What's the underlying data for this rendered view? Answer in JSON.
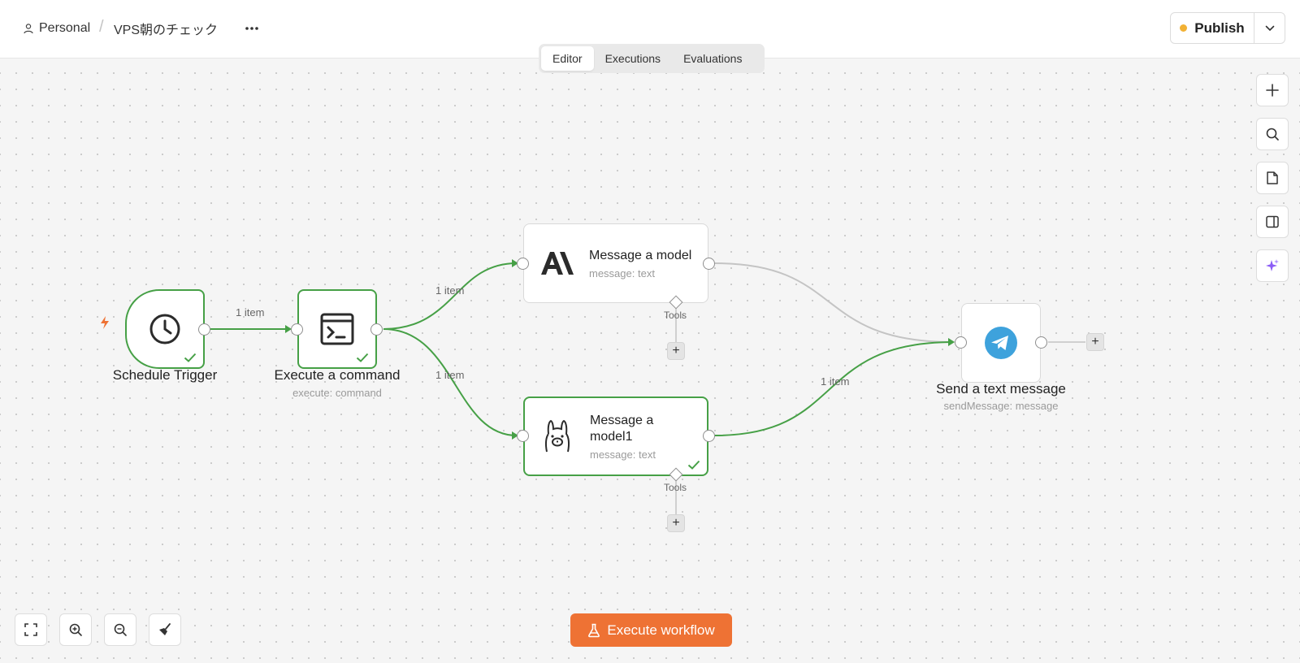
{
  "header": {
    "breadcrumb_personal": "Personal",
    "breadcrumb_separator": "/",
    "workflow_name": "VPS朝のチェック",
    "tabs": [
      {
        "label": "Editor",
        "active": true
      },
      {
        "label": "Executions",
        "active": false
      },
      {
        "label": "Evaluations",
        "active": false
      }
    ],
    "publish_label": "Publish",
    "publish_status_color": "#f2b134"
  },
  "nodes": {
    "schedule_trigger": {
      "title": "Schedule Trigger",
      "icon": "clock-icon",
      "status": "success"
    },
    "execute_command": {
      "title": "Execute a command",
      "subtitle": "execute: command",
      "icon": "terminal-icon",
      "status": "success"
    },
    "message_model": {
      "title": "Message a model",
      "subtitle": "message: text",
      "icon": "anthropic-icon",
      "tools_label": "Tools"
    },
    "message_model1": {
      "title": "Message a model1",
      "subtitle": "message: text",
      "icon": "ollama-icon",
      "status": "success",
      "tools_label": "Tools"
    },
    "send_text": {
      "title": "Send a text message",
      "subtitle": "sendMessage: message",
      "icon": "telegram-icon"
    }
  },
  "edges": {
    "trigger_to_command": "1 item",
    "command_to_model": "1 item",
    "command_to_model1": "1 item",
    "model1_to_send": "1 item"
  },
  "toolbar": {
    "execute_label": "Execute workflow",
    "execute_color": "#ee7234"
  },
  "colors": {
    "success": "#46a046",
    "canvas": "#f5f5f5",
    "ai_sparkle": "#8b5cf6"
  }
}
